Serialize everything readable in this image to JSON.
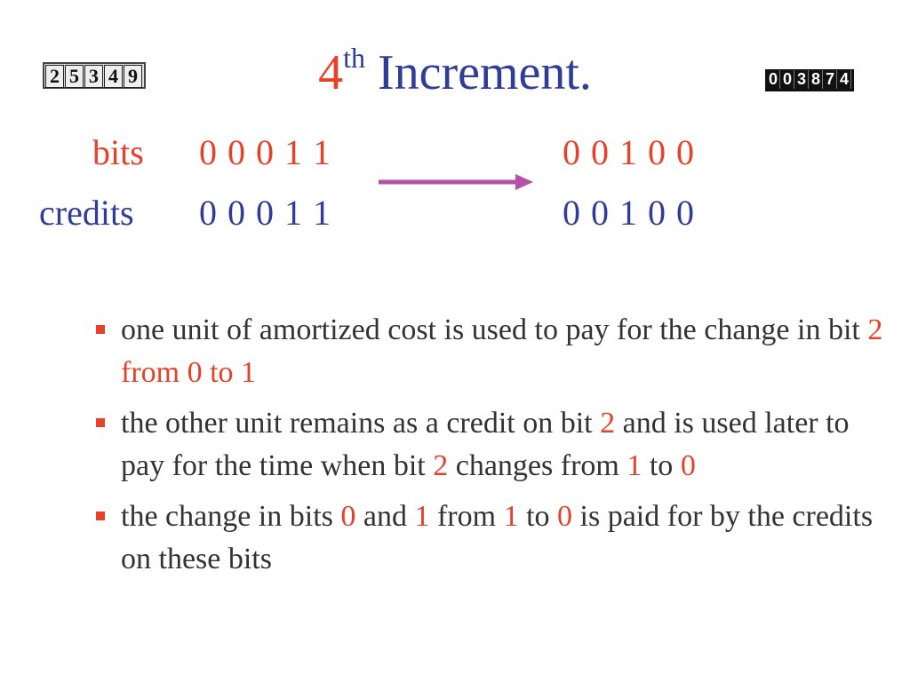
{
  "counters": {
    "left": [
      "2",
      "5",
      "3",
      "4",
      "9"
    ],
    "right": [
      "0",
      "0",
      "3",
      "8",
      "7",
      "4"
    ]
  },
  "title": {
    "ordinal": "4",
    "suffix": "th",
    "text": "Increment."
  },
  "rows": {
    "bits": {
      "label": "bits",
      "before": "0 0 0 1 1",
      "after": "0 0 1 0 0"
    },
    "credits": {
      "label": "credits",
      "before": "0 0 0 1 1",
      "after": "0 0 1 0 0"
    }
  },
  "bullets": [
    {
      "segments": [
        {
          "text": " one unit of amortized cost is used to pay for the change in bit ",
          "color": "dark"
        },
        {
          "text": "2 from 0 to 1",
          "color": "red"
        }
      ]
    },
    {
      "segments": [
        {
          "text": " the other unit remains as a credit on bit ",
          "color": "dark"
        },
        {
          "text": "2",
          "color": "red"
        },
        {
          "text": " and is used later to pay for the time when bit ",
          "color": "dark"
        },
        {
          "text": "2",
          "color": "red"
        },
        {
          "text": " changes from ",
          "color": "dark"
        },
        {
          "text": "1",
          "color": "red"
        },
        {
          "text": " to ",
          "color": "dark"
        },
        {
          "text": "0",
          "color": "red"
        }
      ]
    },
    {
      "segments": [
        {
          "text": " the change in bits ",
          "color": "dark"
        },
        {
          "text": "0",
          "color": "red"
        },
        {
          "text": " and ",
          "color": "dark"
        },
        {
          "text": "1",
          "color": "red"
        },
        {
          "text": " from ",
          "color": "dark"
        },
        {
          "text": "1",
          "color": "red"
        },
        {
          "text": " to ",
          "color": "dark"
        },
        {
          "text": "0",
          "color": "red"
        },
        {
          "text": " is paid for by the credits on these bits",
          "color": "dark"
        }
      ]
    }
  ],
  "colors": {
    "red": "#e8412a",
    "blue": "#2f3d97",
    "dark": "#333333",
    "arrow": "#b452a8"
  }
}
